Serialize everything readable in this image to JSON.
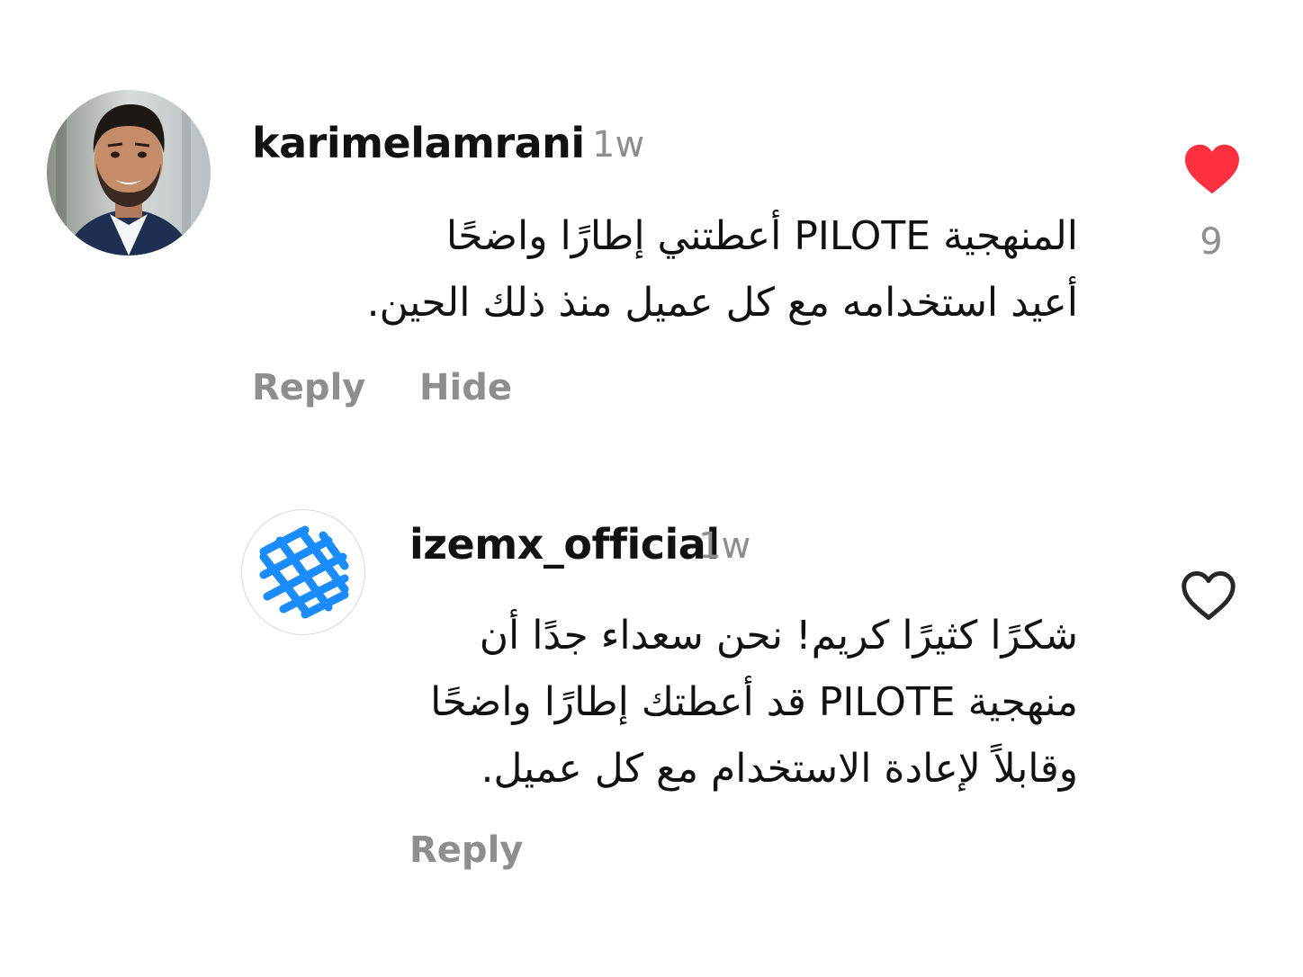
{
  "comments": [
    {
      "username": "karimelamrani",
      "time": "1w",
      "lines": [
        "المنهجية PILOTE أعطتني إطارًا واضحًا",
        "أعيد استخدامه مع كل عميل منذ ذلك الحين."
      ],
      "actions": {
        "reply": "Reply",
        "hide": "Hide"
      },
      "liked": true,
      "like_icon": "heart-filled-icon",
      "like_count": "9",
      "like_color": "#ff3040"
    },
    {
      "username": "izemx_official",
      "time": "1w",
      "lines": [
        "شكرًا كثيرًا كريم! نحن سعداء جدًا أن",
        "منهجية PILOTE قد أعطتك إطارًا واضحًا",
        "وقابلاً لإعادة الاستخدام مع كل عميل."
      ],
      "actions": {
        "reply": "Reply"
      },
      "liked": false,
      "like_icon": "heart-outline-icon",
      "logo_color": "#1a8cff"
    }
  ],
  "colors": {
    "text": "#111111",
    "muted": "#8e8e8e",
    "background": "#ffffff"
  }
}
